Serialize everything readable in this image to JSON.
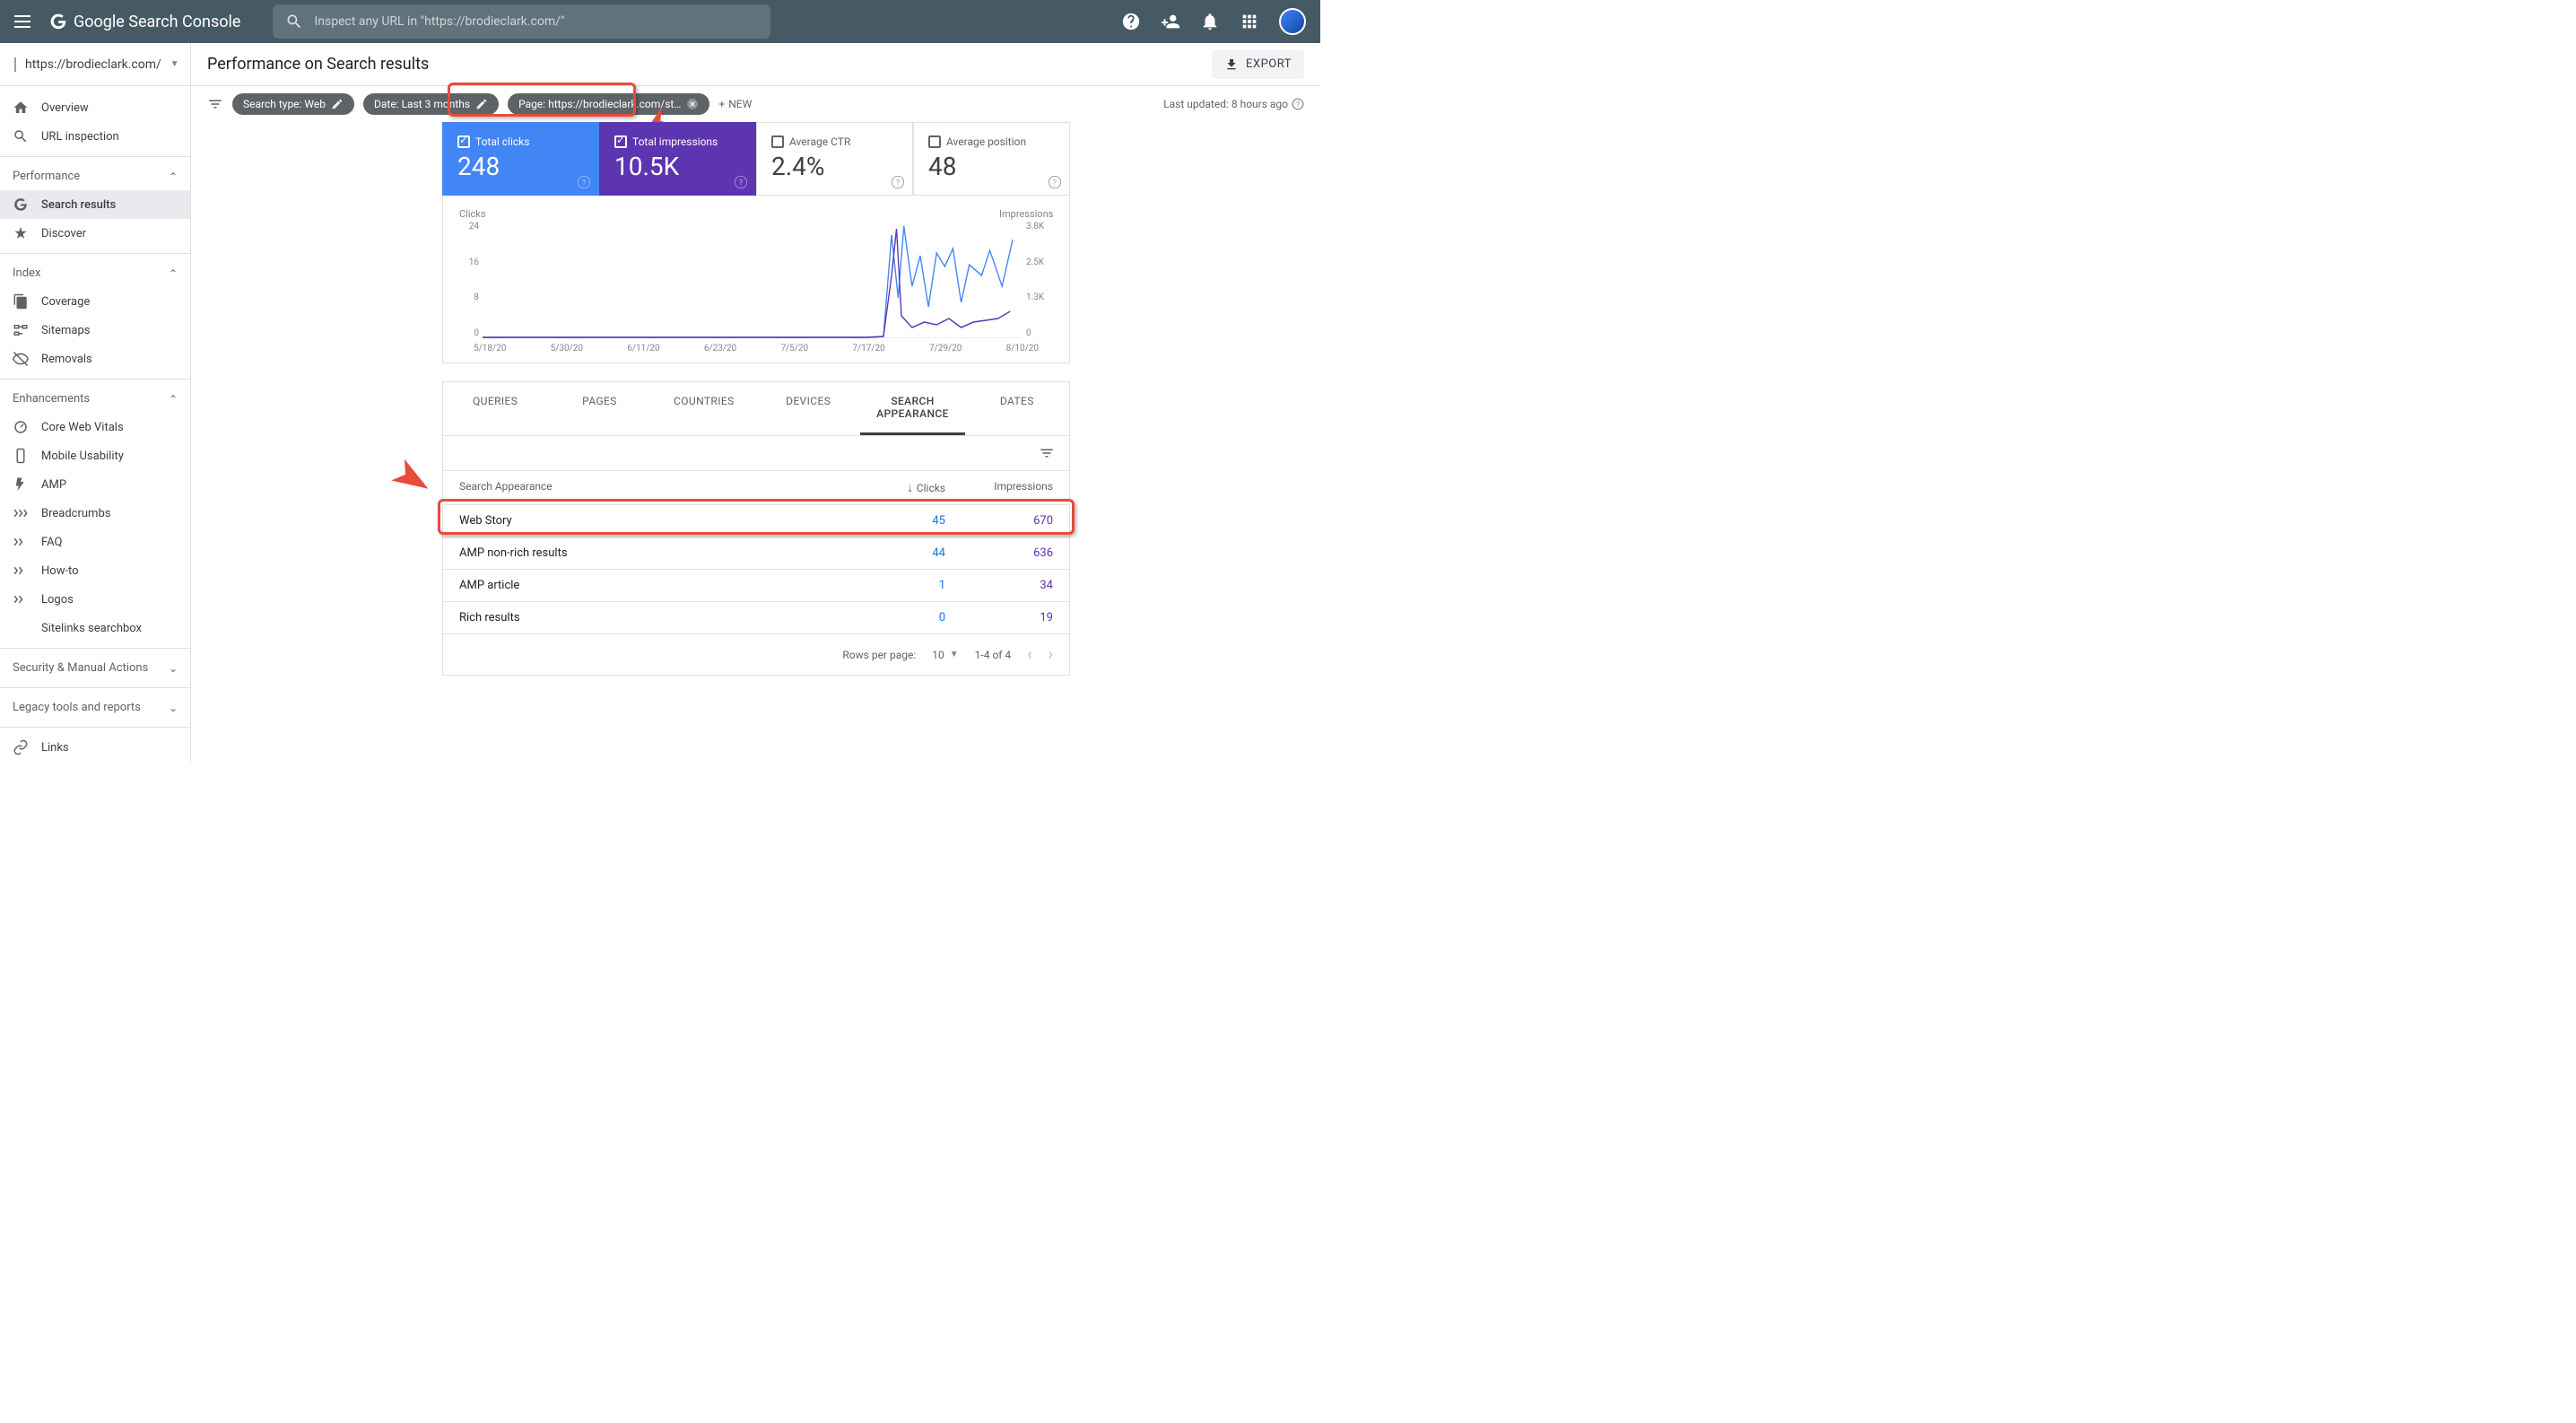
{
  "app_title": "Google Search Console",
  "search_placeholder": "Inspect any URL in \"https://brodieclark.com/\"",
  "property_url": "https://brodieclark.com/",
  "page_title": "Performance on Search results",
  "export_label": "EXPORT",
  "last_updated": "Last updated: 8 hours ago",
  "filter_chips": {
    "search_type": "Search type: Web",
    "date": "Date: Last 3 months",
    "page": "Page: https://brodieclark.com/st…",
    "new": "NEW"
  },
  "sidebar": {
    "overview": "Overview",
    "url_inspection": "URL inspection",
    "performance": "Performance",
    "search_results": "Search results",
    "discover": "Discover",
    "index": "Index",
    "coverage": "Coverage",
    "sitemaps": "Sitemaps",
    "removals": "Removals",
    "enhancements": "Enhancements",
    "cwv": "Core Web Vitals",
    "mobile": "Mobile Usability",
    "amp": "AMP",
    "breadcrumbs": "Breadcrumbs",
    "faq": "FAQ",
    "howto": "How-to",
    "logos": "Logos",
    "sitelinks": "Sitelinks searchbox",
    "security": "Security & Manual Actions",
    "legacy": "Legacy tools and reports",
    "links": "Links"
  },
  "metrics": {
    "clicks_label": "Total clicks",
    "clicks_value": "248",
    "impressions_label": "Total impressions",
    "impressions_value": "10.5K",
    "ctr_label": "Average CTR",
    "ctr_value": "2.4%",
    "position_label": "Average position",
    "position_value": "48"
  },
  "chart": {
    "left_label": "Clicks",
    "right_label": "Impressions",
    "left_ticks": [
      "24",
      "16",
      "8",
      "0"
    ],
    "right_ticks": [
      "3.8K",
      "2.5K",
      "1.3K",
      "0"
    ],
    "x_ticks": [
      "5/18/20",
      "5/30/20",
      "6/11/20",
      "6/23/20",
      "7/5/20",
      "7/17/20",
      "7/29/20",
      "8/10/20"
    ]
  },
  "chart_data": {
    "type": "line",
    "ylabel_left": "Clicks",
    "ylabel_right": "Impressions",
    "ylim_left": [
      0,
      24
    ],
    "ylim_right": [
      0,
      3800
    ],
    "x_range": [
      "2020-05-18",
      "2020-08-14"
    ],
    "note": "Daily values ≈0 until roughly 2020-07-26, then a sharp spike. Approximate peaks read from chart.",
    "series": [
      {
        "name": "Clicks",
        "color": "#4285f4",
        "peak_value": 24,
        "peak_date": "2020-07-29",
        "trend_after_peak": "oscillating 6–22"
      },
      {
        "name": "Impressions",
        "color": "#5e35b1",
        "peak_value": 3800,
        "peak_date": "2020-07-29",
        "trend_after_peak": "drops to ~300–800"
      }
    ]
  },
  "tabs": {
    "queries": "QUERIES",
    "pages": "PAGES",
    "countries": "COUNTRIES",
    "devices": "DEVICES",
    "search_appearance": "SEARCH APPEARANCE",
    "dates": "DATES"
  },
  "table": {
    "col1": "Search Appearance",
    "col2": "Clicks",
    "col3": "Impressions",
    "rows": [
      {
        "name": "Web Story",
        "clicks": "45",
        "impressions": "670"
      },
      {
        "name": "AMP non-rich results",
        "clicks": "44",
        "impressions": "636"
      },
      {
        "name": "AMP article",
        "clicks": "1",
        "impressions": "34"
      },
      {
        "name": "Rich results",
        "clicks": "0",
        "impressions": "19"
      }
    ],
    "rows_per_page_label": "Rows per page:",
    "rows_per_page_value": "10",
    "range": "1-4 of 4"
  }
}
